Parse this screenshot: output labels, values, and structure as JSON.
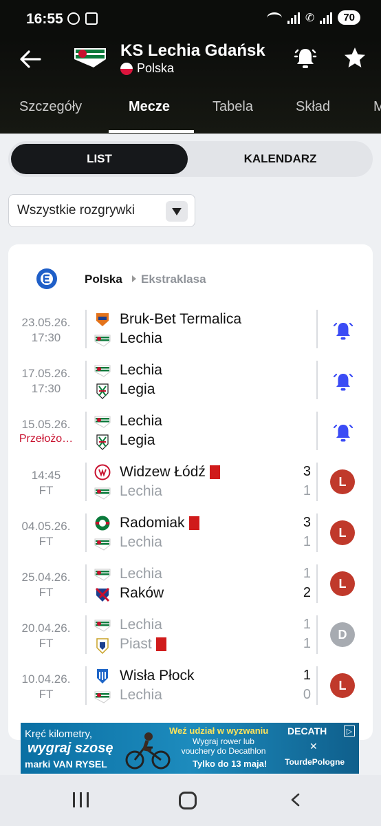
{
  "status_bar": {
    "time": "16:55",
    "battery": "70"
  },
  "header": {
    "title": "KS Lechia Gdańsk",
    "country": "Polska",
    "tabs": [
      "Szczegóły",
      "Mecze",
      "Tabela",
      "Skład",
      "M"
    ],
    "active_tab": "Mecze"
  },
  "toggle": {
    "list_label": "LIST",
    "calendar_label": "KALENDARZ"
  },
  "filter": {
    "selected": "Wszystkie rozgrywki"
  },
  "league": {
    "country": "Polska",
    "name": "Ekstraklasa"
  },
  "matches": [
    {
      "date": "23.05.26.",
      "status": "17:30",
      "home": "Bruk-Bet Termalica",
      "away": "Lechia",
      "type": "upcoming"
    },
    {
      "date": "17.05.26.",
      "status": "17:30",
      "home": "Lechia",
      "away": "Legia",
      "type": "upcoming"
    },
    {
      "date": "15.05.26.",
      "status": "Przełożo…",
      "home": "Lechia",
      "away": "Legia",
      "type": "upcoming"
    },
    {
      "date": "14:45",
      "status": "FT",
      "home": "Widzew Łódź",
      "away": "Lechia",
      "home_score": "3",
      "away_score": "1",
      "result": "L"
    },
    {
      "date": "04.05.26.",
      "status": "FT",
      "home": "Radomiak",
      "away": "Lechia",
      "home_score": "3",
      "away_score": "1",
      "result": "L"
    },
    {
      "date": "25.04.26.",
      "status": "FT",
      "home": "Lechia",
      "away": "Raków",
      "home_score": "1",
      "away_score": "2",
      "result": "L"
    },
    {
      "date": "20.04.26.",
      "status": "FT",
      "home": "Lechia",
      "away": "Piast",
      "home_score": "1",
      "away_score": "1",
      "result": "D"
    },
    {
      "date": "10.04.26.",
      "status": "FT",
      "home": "Wisła Płock",
      "away": "Lechia",
      "home_score": "1",
      "away_score": "0",
      "result": "L"
    }
  ],
  "ad": {
    "line1": "Kręć kilometry,",
    "line2": "wygraj szosę",
    "brand": "marki VAN RYSEL",
    "headline": "Weź udział w wyzwaniu",
    "body": "Wygraj rower lub vouchery do Decathlon",
    "deadline": "Tylko do 13 maja!",
    "sponsor": "DECATH",
    "event": "TourdePologne"
  },
  "colors": {
    "loss": "#c0392b",
    "draw": "#a7abb1",
    "bell": "#3b4cf5",
    "red_card": "#d01b1b",
    "postponed": "#c8102e"
  }
}
